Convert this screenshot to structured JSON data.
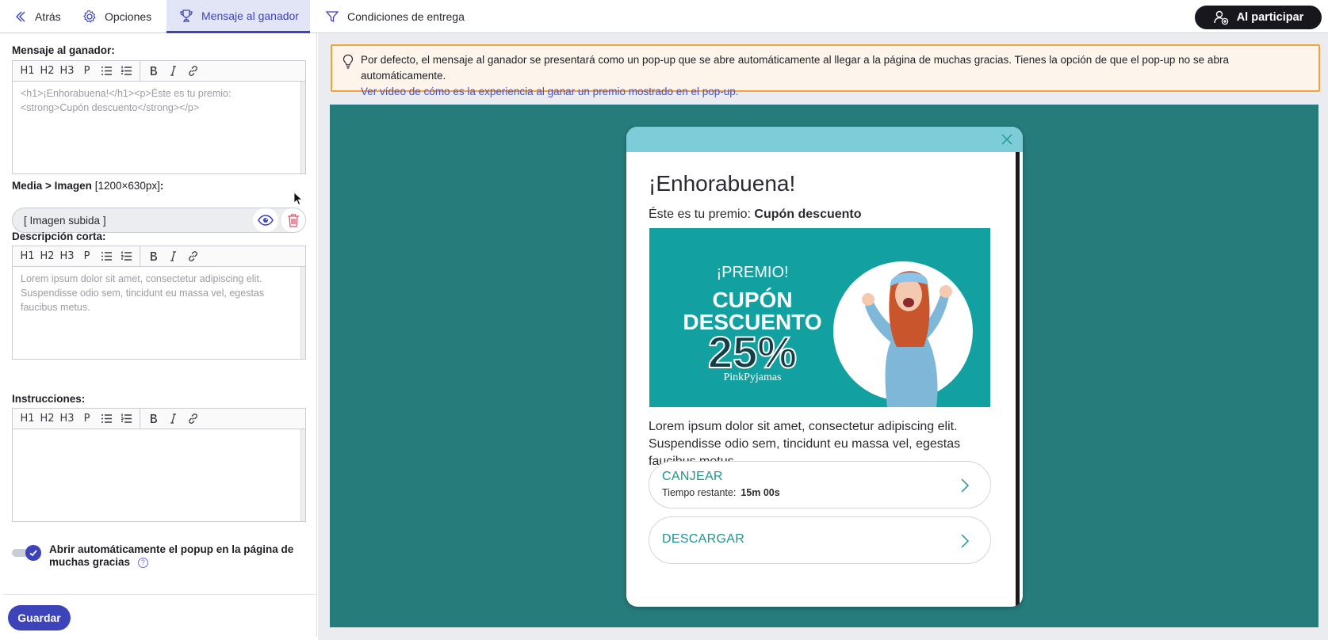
{
  "topbar": {
    "back_label": "Atrás",
    "options_label": "Opciones",
    "winner_label": "Mensaje al ganador",
    "delivery_label": "Condiciones de entrega",
    "participate_label": "Al participar"
  },
  "toolbar": {
    "h1": "H1",
    "h2": "H2",
    "h3": "H3",
    "p": "P"
  },
  "left": {
    "winner_message_label": "Mensaje al ganador:",
    "winner_message_value": "<h1>¡Enhorabuena!</h1><p>Éste es tu premio: <strong>Cupón descuento</strong></p>",
    "media_label": "Media > Imagen",
    "media_size": "[1200×630px]",
    "media_colon": ":",
    "uploaded_label": "[ Imagen subida ]",
    "short_desc_label": "Descripción corta:",
    "short_desc_value": "Lorem ipsum dolor sit amet, consectetur adipiscing elit. Suspendisse odio sem, tincidunt eu massa vel, egestas faucibus metus.",
    "instructions_label": "Instrucciones:",
    "instructions_value": "",
    "auto_open_label": "Abrir automáticamente el popup en la página de muchas gracias",
    "help_glyph": "?",
    "save_label": "Guardar"
  },
  "info": {
    "text": "Por defecto, el mensaje al ganador se presentará como un pop-up que se abre automáticamente al llegar a la página de muchas gracias. Tienes la opción de que el pop-up no se abra automáticamente.",
    "link": "Ver vídeo de cómo es la experiencia al ganar un premio mostrado en el pop-up."
  },
  "popup": {
    "title": "¡Enhorabuena!",
    "subtitle_prefix": "Éste es tu premio:",
    "subtitle_bold": "Cupón descuento",
    "image": {
      "premio": "¡PREMIO!",
      "cupon": "CUPÓN",
      "descuento": "DESCUENTO",
      "percent": "25%",
      "brand": "PinkPyjamas"
    },
    "description": "Lorem ipsum dolor sit amet, consectetur adipiscing elit. Suspendisse odio sem, tincidunt eu massa vel, egestas faucibus metus.",
    "redeem_label": "CANJEAR",
    "time_left_label": "Tiempo restante:",
    "time_left_value": "15m 00s",
    "download_label": "DESCARGAR"
  },
  "colors": {
    "accent": "#3d43b8",
    "stage": "#267b7b",
    "popup_head": "#7ccdd8",
    "info_border": "#f2a33a",
    "cta_text": "#1e9494"
  }
}
